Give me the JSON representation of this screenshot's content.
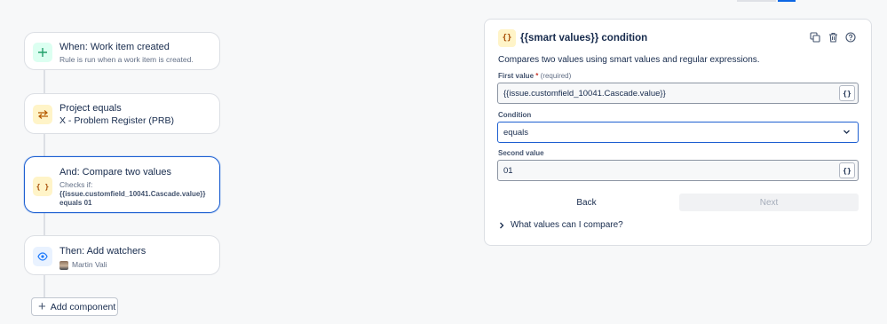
{
  "flow": {
    "trigger": {
      "title": "When: Work item created",
      "subtitle": "Rule is run when a work item is created.",
      "icon": "plus-icon",
      "color": "#22a06b"
    },
    "condition1": {
      "title": "Project equals",
      "subtitle": "X - Problem Register (PRB)",
      "icon": "swap-arrows-icon",
      "color": "#e2a117"
    },
    "condition2": {
      "title": "And: Compare two values",
      "checks_label": "Checks if:",
      "checks_expr": "{{issue.customfield_10041.Cascade.value}}",
      "checks_cond": "equals 01",
      "icon": "braces-icon",
      "color": "#e2a117"
    },
    "action": {
      "title": "Then: Add watchers",
      "user": "Martin Vali",
      "icon": "eye-icon",
      "color": "#1d7afc"
    },
    "add_component_label": "Add component"
  },
  "panel": {
    "icon_text": "{}",
    "title": "{{smart values}} condition",
    "description": "Compares two values using smart values and regular expressions.",
    "first_value_label": "First value",
    "first_value_required": "(required)",
    "first_value": "{{issue.customfield_10041.Cascade.value}}",
    "condition_label": "Condition",
    "condition_value": "equals",
    "second_value_label": "Second value",
    "second_value": "01",
    "smart_value_button": "{}",
    "back_label": "Back",
    "next_label": "Next",
    "faq_label": "What values can I compare?"
  }
}
